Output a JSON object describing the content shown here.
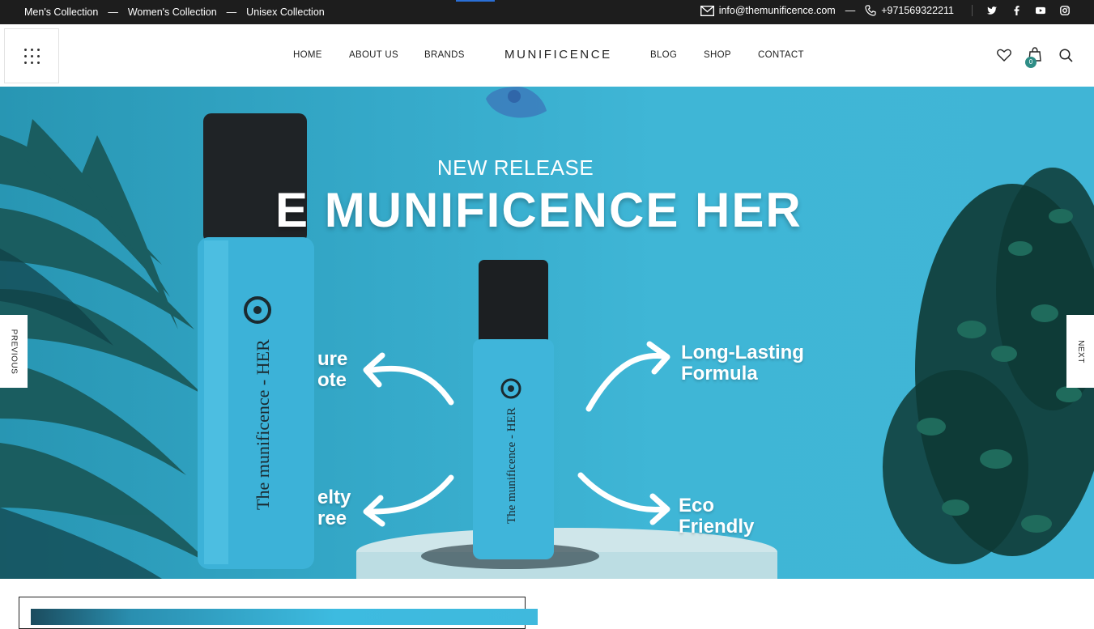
{
  "topbar": {
    "collections": [
      "Men's Collection",
      "Women's Collection",
      "Unisex Collection"
    ],
    "separator": "—",
    "email": "info@themunificence.com",
    "phone": "+971569322211",
    "social_icons": [
      "twitter-icon",
      "facebook-icon",
      "youtube-icon",
      "instagram-icon"
    ]
  },
  "header": {
    "brand": "MUNIFICENCE",
    "nav_left": [
      "HOME",
      "ABOUT US",
      "BRANDS"
    ],
    "nav_right": [
      "BLOG",
      "SHOP",
      "CONTACT"
    ],
    "active_item": "HOME",
    "cart_count": "0"
  },
  "hero": {
    "eyebrow": "NEW RELEASE",
    "title": "E MUNIFICENCE HER",
    "features": {
      "top_left": [
        "ure",
        "ote"
      ],
      "bottom_left": [
        "elty",
        "ree"
      ],
      "top_right": [
        "Long-Lasting",
        "Formula"
      ],
      "bottom_right": [
        "Eco",
        "Friendly"
      ]
    },
    "bottle_label": "The munificence - HER",
    "prev_label": "PREVIOUS",
    "next_label": "NEXT"
  },
  "colors": {
    "topbar_bg": "#1d1d1d",
    "hero_bg": "#3fb6d6",
    "accent": "#2e8d86"
  }
}
